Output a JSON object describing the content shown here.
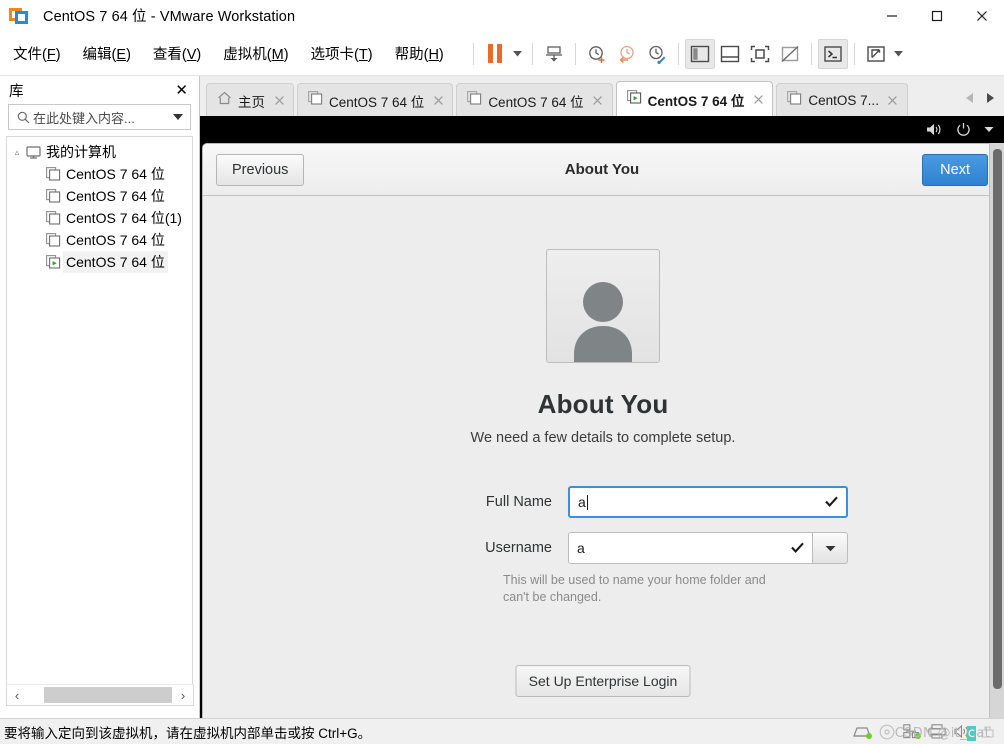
{
  "window": {
    "title": "CentOS 7 64 位 - VMware Workstation",
    "app_icon": "vmware-workstation-icon",
    "controls": [
      {
        "name": "minimize",
        "glyph": "minimize-icon"
      },
      {
        "name": "maximize",
        "glyph": "maximize-icon"
      },
      {
        "name": "close",
        "glyph": "close-icon"
      }
    ]
  },
  "menubar": {
    "items": [
      {
        "label": "文件(F)",
        "text": "文件(",
        "accel": "F",
        "tail": ")"
      },
      {
        "label": "编辑(E)",
        "text": "编辑(",
        "accel": "E",
        "tail": ")"
      },
      {
        "label": "查看(V)",
        "text": "查看(",
        "accel": "V",
        "tail": ")"
      },
      {
        "label": "虚拟机(M)",
        "text": "虚拟机(",
        "accel": "M",
        "tail": ")"
      },
      {
        "label": "选项卡(T)",
        "text": "选项卡(",
        "accel": "T",
        "tail": ")"
      },
      {
        "label": "帮助(H)",
        "text": "帮助(",
        "accel": "H",
        "tail": ")"
      }
    ]
  },
  "toolbar": {
    "items": [
      {
        "name": "suspend-button",
        "icon": "pause-icon"
      },
      {
        "name": "suspend-dropdown",
        "icon": "chevron-down-icon"
      },
      {
        "name": "power-on-guest-button",
        "icon": "power-on-icon"
      },
      {
        "name": "take-snapshot-button",
        "icon": "snapshot-icon"
      },
      {
        "name": "revert-snapshot-button",
        "icon": "revert-snapshot-icon"
      },
      {
        "name": "manage-snapshots-button",
        "icon": "manage-snapshots-icon"
      },
      {
        "name": "show-library-button",
        "icon": "library-panel-icon"
      },
      {
        "name": "show-thumbnail-bar-button",
        "icon": "thumbnail-bar-icon"
      },
      {
        "name": "enter-fullscreen-button",
        "icon": "fullscreen-icon"
      },
      {
        "name": "unity-mode-button",
        "icon": "unity-mode-icon"
      },
      {
        "name": "console-button",
        "icon": "console-icon"
      },
      {
        "name": "stretch-guest-button",
        "icon": "stretch-icon"
      },
      {
        "name": "stretch-dropdown",
        "icon": "chevron-down-icon"
      }
    ]
  },
  "library": {
    "title": "库",
    "close_label": "✕",
    "search": {
      "placeholder": "在此处键入内容...",
      "value": "",
      "icon": "search-icon",
      "dropdown_icon": "chevron-down-icon"
    },
    "tree": [
      {
        "label": "我的计算机",
        "level": 0,
        "icon": "my-computer-icon",
        "selected": false,
        "expander": "expanded"
      },
      {
        "label": "CentOS 7 64 位",
        "level": 1,
        "icon": "vm-powered-off-icon",
        "selected": false
      },
      {
        "label": "CentOS 7 64 位",
        "level": 1,
        "icon": "vm-powered-off-icon",
        "selected": false
      },
      {
        "label": "CentOS 7 64 位(1)",
        "level": 1,
        "icon": "vm-powered-off-icon",
        "selected": false
      },
      {
        "label": "CentOS 7 64 位",
        "level": 1,
        "icon": "vm-powered-off-icon",
        "selected": false
      },
      {
        "label": "CentOS 7 64 位",
        "level": 1,
        "icon": "vm-running-icon",
        "selected": true
      }
    ],
    "hscroll": {
      "left_arrow": "‹",
      "right_arrow": "›"
    }
  },
  "tabs": {
    "items": [
      {
        "label": "主页",
        "icon": "home-icon",
        "active": false,
        "closable": true
      },
      {
        "label": "CentOS 7 64 位",
        "icon": "vm-powered-off-icon",
        "active": false,
        "closable": true
      },
      {
        "label": "CentOS 7 64 位",
        "icon": "vm-powered-off-icon",
        "active": false,
        "closable": true
      },
      {
        "label": "CentOS 7 64 位",
        "icon": "vm-running-icon",
        "active": true,
        "closable": true
      },
      {
        "label": "CentOS 7...",
        "icon": "vm-powered-off-icon",
        "active": false,
        "closable": true
      }
    ],
    "nav": {
      "prev_icon": "triangle-left-icon",
      "next_icon": "triangle-right-icon"
    }
  },
  "guest": {
    "top_bar": {
      "volume_icon": "speaker-icon",
      "power_icon": "power-icon",
      "menu_icon": "chevron-down-icon"
    },
    "setup": {
      "previous_label": "Previous",
      "header_title": "About You",
      "next_label": "Next",
      "avatar_icon": "user-avatar-icon",
      "page_title": "About You",
      "page_subtitle": "We need a few details to complete setup.",
      "fields": [
        {
          "name": "full-name",
          "label": "Full Name",
          "value": "a",
          "focused": true,
          "valid_icon": "check-icon",
          "has_dropdown": false
        },
        {
          "name": "username",
          "label": "Username",
          "value": "a",
          "focused": false,
          "valid_icon": "check-icon",
          "has_dropdown": true,
          "dropdown_icon": "chevron-down-icon"
        }
      ],
      "hint": "This will be used to name your home folder and can't be changed.",
      "enterprise_button_label": "Set Up Enterprise Login"
    },
    "scrollbar": {
      "name": "vertical-scrollbar"
    }
  },
  "statusbar": {
    "message": "要将输入定向到该虚拟机，请在虚拟机内部单击或按 Ctrl+G。",
    "icons": [
      {
        "name": "hard-disk-icon",
        "connected": true
      },
      {
        "name": "cd-dvd-icon",
        "connected": false
      },
      {
        "name": "network-adapter-icon",
        "connected": true
      },
      {
        "name": "printer-icon",
        "connected": false
      },
      {
        "name": "sound-card-icon",
        "connected": true
      },
      {
        "name": "usb-device-icon",
        "connected": false
      }
    ],
    "watermark": {
      "prefix": "CSDN @it_",
      "highlight": "c",
      "suffix": "at"
    }
  },
  "colors": {
    "accent_blue": "#3b8fe0",
    "next_button": "#2f82d1",
    "orange": "#ec6a28",
    "vm_bg": "#000000",
    "setup_bg": "#ededed",
    "status_green": "#6fcf2a"
  }
}
